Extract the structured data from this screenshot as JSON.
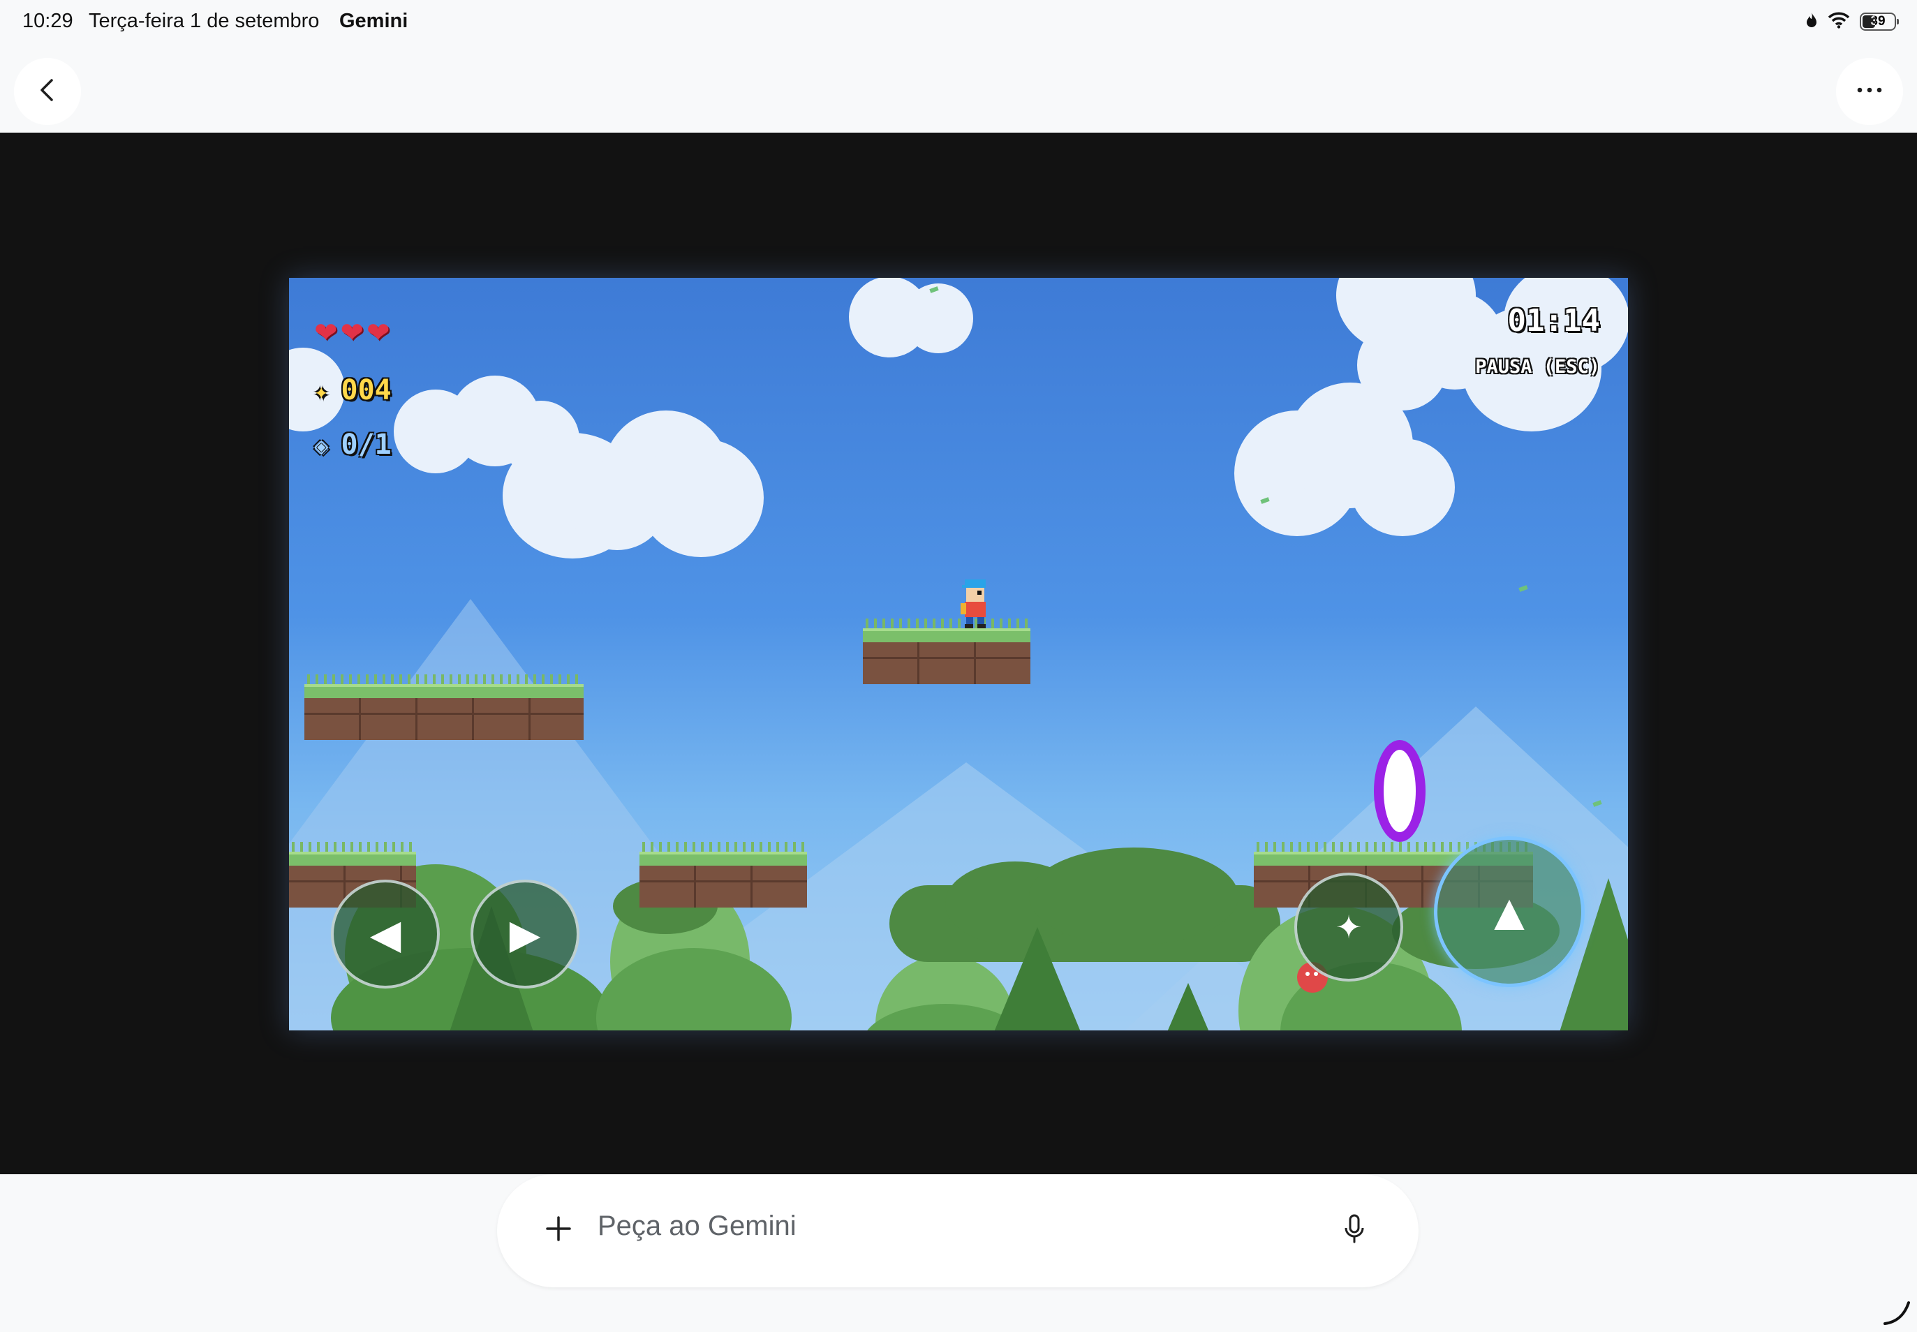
{
  "status_bar": {
    "time": "10:29",
    "date": "Terça-feira 1 de setembro",
    "app_name": "Gemini",
    "battery": "39"
  },
  "nav": {
    "back_icon": "chevron-left-icon",
    "more_icon": "more-horizontal-icon"
  },
  "game": {
    "hud": {
      "hearts": "❤❤❤",
      "lives": 3,
      "coin_icon": "✦",
      "coins": "004",
      "gem_icon": "◈",
      "gems": "0/1",
      "timer": "01:14",
      "pause_label": "PAUSA (ESC)"
    },
    "controls": {
      "left": "◀",
      "right": "▶",
      "action": "✦",
      "jump": "▲"
    },
    "colors": {
      "sky_top": "#3e7bd6",
      "sky_bottom": "#9ccdf5",
      "portal": "#9b22e6",
      "grass": "#7bbf6a",
      "dirt": "#7a5240"
    }
  },
  "prompt": {
    "placeholder": "Peça ao Gemini",
    "plus_icon": "plus-icon",
    "mic_icon": "microphone-icon"
  }
}
